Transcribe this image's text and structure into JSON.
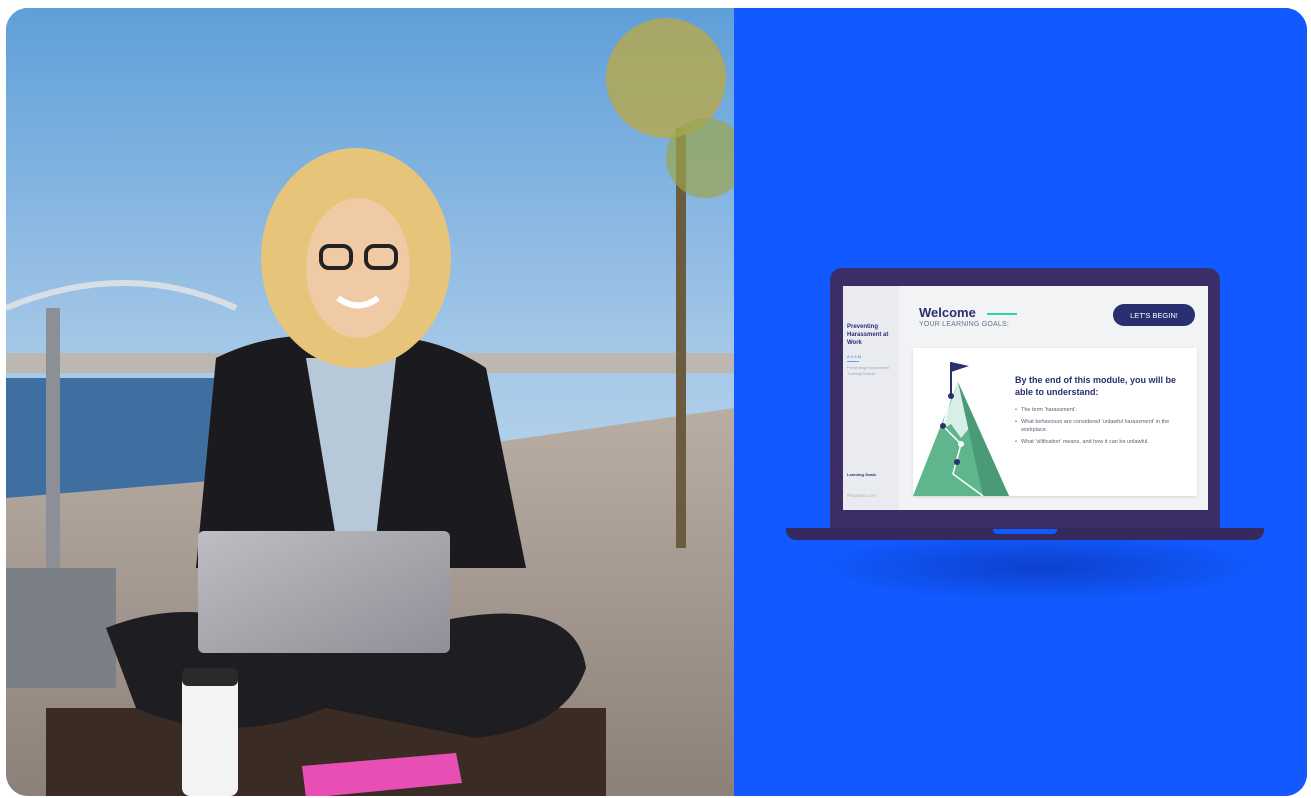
{
  "course": {
    "title": "Preventing Harassment at Work",
    "code": "AZAM",
    "subtitle": "Preventing Harassment Training Module",
    "section_label": "Learning Goals",
    "progress": "PROGRESS: 17%"
  },
  "header": {
    "title": "Welcome",
    "goals_label": "YOUR LEARNING GOALS:",
    "begin_button": "LET'S BEGIN!"
  },
  "goals": {
    "heading": "By the end of this module, you will be able to understand:",
    "items": [
      "The term 'harassment'.",
      "What behaviours are considered 'unlawful harassment' in the workplace.",
      "What 'vilification' means, and how it can be unlawful."
    ]
  },
  "colors": {
    "background_blue": "#1259ff",
    "laptop_frame": "#3b2e66",
    "navy_text": "#28306f",
    "accent_teal": "#2ad3b0",
    "mountain_green": "#5fb58c"
  }
}
